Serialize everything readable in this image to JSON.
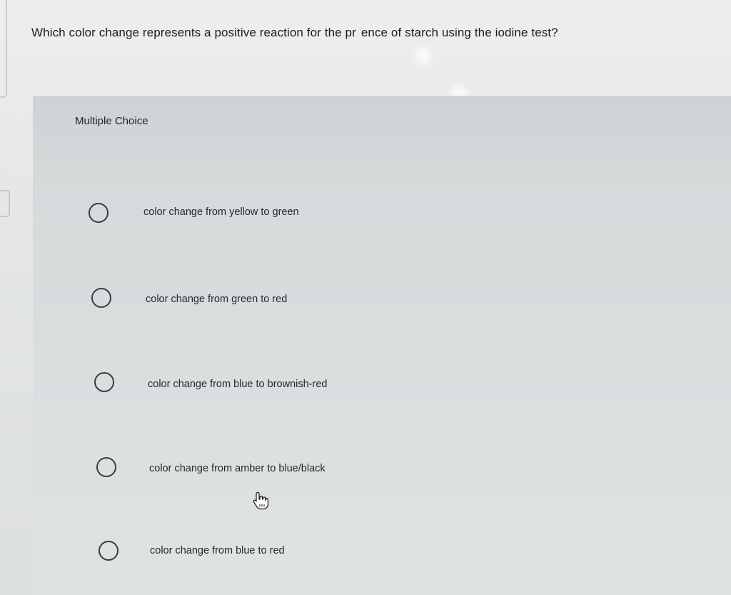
{
  "question": {
    "text": "Which color change represents a positive reaction for the pr  ence of starch using the iodine test?"
  },
  "answer_panel": {
    "label": "Multiple Choice",
    "choices": [
      {
        "text": "color change from yellow to green"
      },
      {
        "text": "color change from green to red"
      },
      {
        "text": "color change from blue to brownish-red"
      },
      {
        "text": "color change from amber to blue/black"
      },
      {
        "text": "color change from blue to red"
      }
    ]
  },
  "icons": {
    "pointer": "hand-pointer-icon",
    "radio": "radio-circle-icon"
  }
}
